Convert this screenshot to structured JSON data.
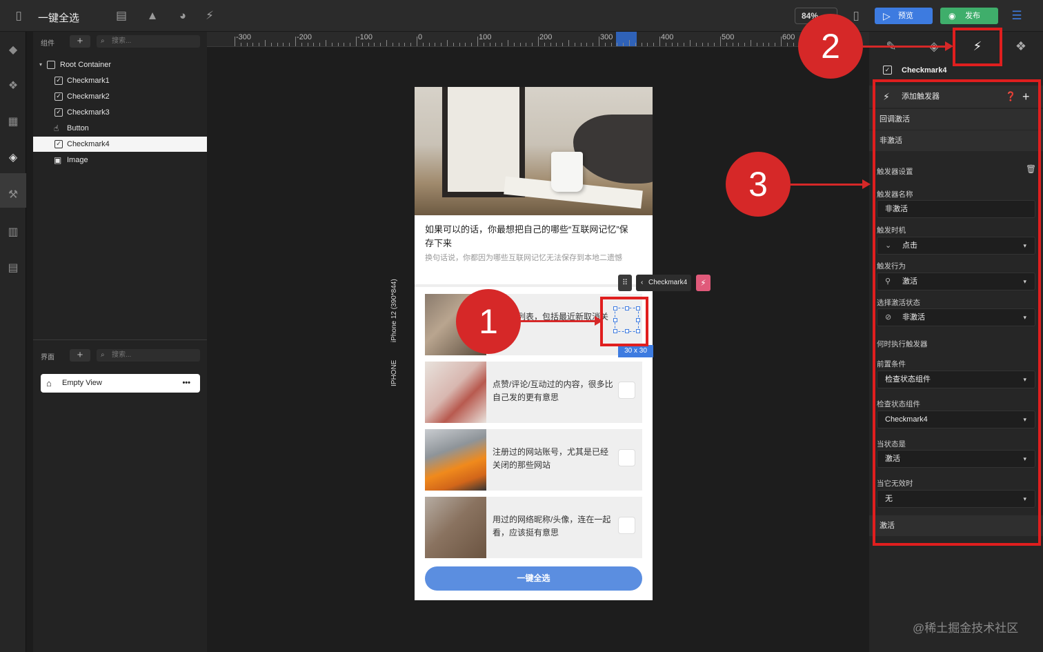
{
  "app": {
    "title": "一键全选",
    "zoom": "84%"
  },
  "toolbar": {
    "preview_label": "预览",
    "publish_label": "发布"
  },
  "left_panel": {
    "components_label": "组件",
    "search_placeholder": "搜索...",
    "tree": [
      {
        "label": "Root Container",
        "icon": "container-icon"
      },
      {
        "label": "Checkmark1",
        "icon": "checkbox-icon"
      },
      {
        "label": "Checkmark2",
        "icon": "checkbox-icon"
      },
      {
        "label": "Checkmark3",
        "icon": "checkbox-icon"
      },
      {
        "label": "Button",
        "icon": "hand-pointer-icon"
      },
      {
        "label": "Checkmark4",
        "icon": "checkbox-icon",
        "selected": true
      },
      {
        "label": "Image",
        "icon": "image-icon"
      }
    ],
    "screens_label": "界面",
    "screens_search_placeholder": "搜索...",
    "screens": [
      {
        "label": "Empty View"
      }
    ]
  },
  "ruler": {
    "labels": [
      "-300",
      "-200",
      "-100",
      "0",
      "100",
      "200",
      "300",
      "400",
      "500",
      "600"
    ]
  },
  "device": {
    "label": "IPHONE",
    "model": "iPhone 12 (390*844)"
  },
  "phone": {
    "post_title": "如果可以的话，你最想把自己的哪些“互联网记忆”保存下来",
    "post_subtitle": "换句话说，你都因为哪些互联网记忆无法保存到本地二遗憾",
    "rows": [
      {
        "text": "本关注列表，包括最近新取消关注了谁"
      },
      {
        "text": "点赞/评论/互动过的内容，很多比自己发的更有意思"
      },
      {
        "text": "注册过的网站账号，尤其是已经关闭的那些网站"
      },
      {
        "text": "用过的网络昵称/头像，连在一起看，应该挺有意思"
      }
    ],
    "button_label": "一键全选"
  },
  "selection": {
    "component": "Checkmark4",
    "size": "30 x 30"
  },
  "right_panel": {
    "component_name": "Checkmark4",
    "add_trigger_label": "添加触发器",
    "callbacks": [
      "回调激活",
      "非激活"
    ],
    "trigger_settings_label": "触发器设置",
    "trigger_name_label": "触发器名称",
    "trigger_name_value": "非激活",
    "trigger_time_label": "触发时机",
    "trigger_time_value": "点击",
    "trigger_action_label": "触发行为",
    "trigger_action_value": "激活",
    "select_state_label": "选择激活状态",
    "select_state_value": "非激活",
    "when_run_label": "何时执行触发器",
    "precondition_label": "前置条件",
    "precondition_value": "检查状态组件",
    "check_component_label": "检查状态组件",
    "check_component_value": "Checkmark4",
    "when_state_label": "当状态是",
    "when_state_value": "激活",
    "when_invalid_label": "当它无效时",
    "when_invalid_value": "无",
    "footer_section": "激活"
  },
  "annotations": {
    "step1": "1",
    "step2": "2",
    "step3": "3",
    "accent": "#d62828"
  },
  "watermark": "@稀土掘金技术社区"
}
